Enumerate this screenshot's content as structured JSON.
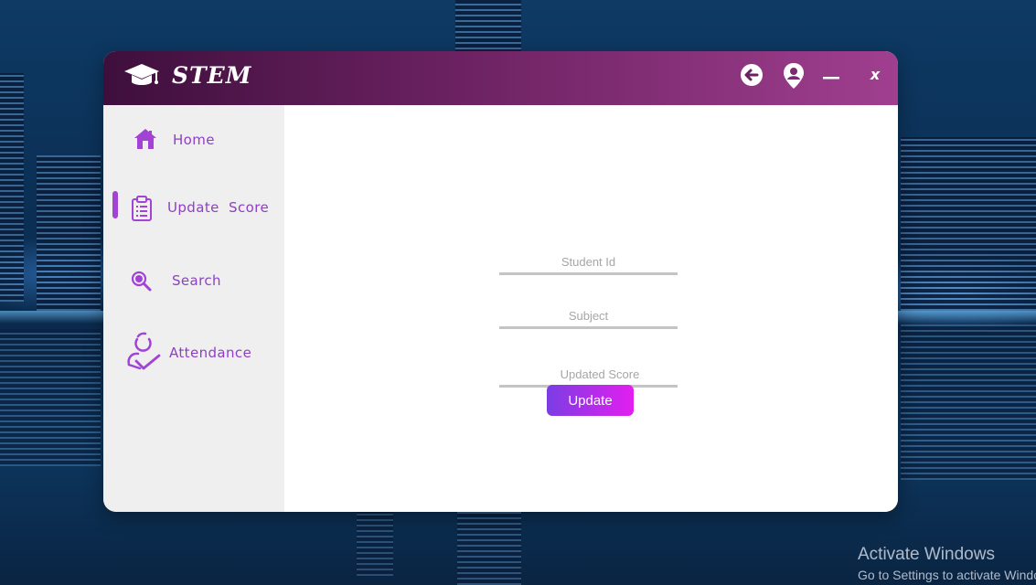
{
  "app": {
    "title": "STEM"
  },
  "titlebar": {
    "icons": [
      "graduation-cap-icon",
      "back-arrow-icon",
      "user-pin-icon",
      "minimize-icon"
    ],
    "close_label": "x"
  },
  "sidebar": {
    "items": [
      {
        "label": "Home",
        "icon": "home-icon",
        "active": false
      },
      {
        "label": "Update  Score",
        "icon": "clipboard-icon",
        "active": true
      },
      {
        "label": "Search",
        "icon": "search-icon",
        "active": false
      },
      {
        "label": "Attendance",
        "icon": "attendance-icon",
        "active": false
      }
    ]
  },
  "form": {
    "student_id": {
      "placeholder": "Student Id",
      "value": ""
    },
    "subject": {
      "placeholder": "Subject",
      "value": ""
    },
    "updated_score": {
      "placeholder": "Updated Score",
      "value": ""
    },
    "submit_label": "Update"
  },
  "watermark": {
    "title": "Activate Windows",
    "subtitle": "Go to Settings to activate Windows."
  },
  "colors": {
    "accent": "#a243d6",
    "titlebar_start": "#3e0f3c",
    "titlebar_end": "#a03f8f",
    "button_start": "#7b3de3",
    "button_end": "#e31ef0",
    "sidebar_bg": "#efefef"
  }
}
